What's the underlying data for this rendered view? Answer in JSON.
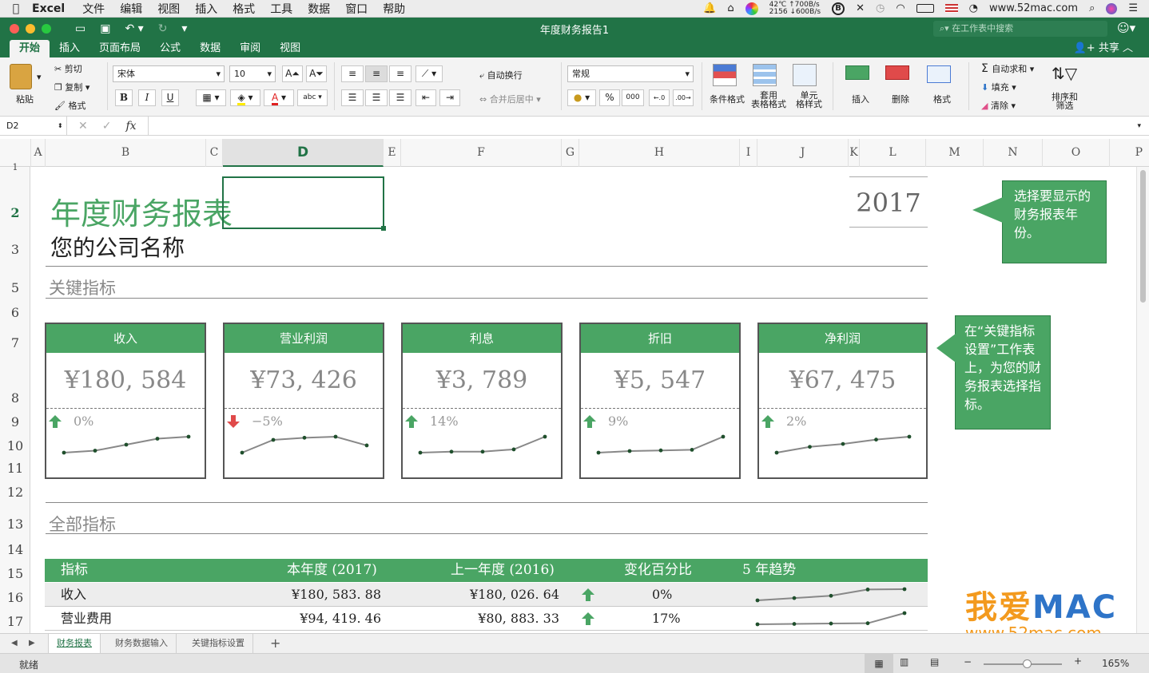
{
  "menubar": {
    "app": "Excel",
    "items": [
      "文件",
      "编辑",
      "视图",
      "插入",
      "格式",
      "工具",
      "数据",
      "窗口",
      "帮助"
    ],
    "temp": "42℃",
    "fan": "2156",
    "net_up": "↑700B/s",
    "net_down": "↓600B/s",
    "site": "www.52mac.com"
  },
  "window": {
    "title": "年度财务报告1",
    "search_placeholder": "在工作表中搜索"
  },
  "ribbon_tabs": [
    "开始",
    "插入",
    "页面布局",
    "公式",
    "数据",
    "审阅",
    "视图"
  ],
  "share_label": "共享",
  "ribbon": {
    "paste": "粘贴",
    "cut": "剪切",
    "copy": "复制",
    "format_painter": "格式",
    "font_name": "宋体",
    "font_size": "10",
    "bold": "B",
    "italic": "I",
    "underline": "U",
    "wrap_text": "自动换行",
    "merge_center": "合并后居中",
    "number_format": "常规",
    "percent": "%",
    "thousands": "000",
    "conditional_format": "条件格式",
    "table_format": "套用\n表格格式",
    "table_format_l1": "套用",
    "table_format_l2": "表格格式",
    "cell_style_l1": "单元",
    "cell_style_l2": "格样式",
    "insert": "插入",
    "delete": "删除",
    "format": "格式",
    "autosum": "自动求和",
    "fill": "填充",
    "clear": "清除",
    "sort_l1": "排序和",
    "sort_l2": "筛选"
  },
  "formula_bar": {
    "name_box": "D2",
    "fx": "fx",
    "value": ""
  },
  "columns": [
    "A",
    "B",
    "C",
    "D",
    "E",
    "F",
    "G",
    "H",
    "I",
    "J",
    "K",
    "L",
    "M",
    "N",
    "O",
    "P"
  ],
  "rows": [
    "1",
    "2",
    "3",
    "5",
    "6",
    "7",
    "8",
    "9",
    "10",
    "11",
    "12",
    "13",
    "14",
    "15",
    "16",
    "17"
  ],
  "sheet": {
    "title": "年度财务报表",
    "company": "您的公司名称",
    "year": "2017",
    "key_metrics_heading": "关键指标",
    "all_metrics_heading": "全部指标",
    "callout_year": "选择要显示的财务报表年份。",
    "callout_metrics": "在“关键指标设置”工作表上，为您的财务报表选择指标。",
    "cards": [
      {
        "label": "收入",
        "value": "¥180, 584",
        "change": "0%",
        "trend": "up",
        "spark": [
          180.0,
          180.1,
          180.4,
          180.7,
          180.8
        ]
      },
      {
        "label": "营业利润",
        "value": "¥73, 426",
        "change": "−5%",
        "trend": "down",
        "spark": [
          70,
          76,
          77,
          77.5,
          73.4
        ]
      },
      {
        "label": "利息",
        "value": "¥3, 789",
        "change": "14%",
        "trend": "up",
        "spark": [
          3.3,
          3.33,
          3.33,
          3.4,
          3.79
        ]
      },
      {
        "label": "折旧",
        "value": "¥5, 547",
        "change": "9%",
        "trend": "up",
        "spark": [
          5.05,
          5.1,
          5.12,
          5.14,
          5.55
        ]
      },
      {
        "label": "净利润",
        "value": "¥67, 475",
        "change": "2%",
        "trend": "up",
        "spark": [
          62,
          64,
          65,
          66.5,
          67.5
        ]
      }
    ],
    "table": {
      "headers": [
        "指标",
        "本年度 (2017)",
        "上一年度 (2016)",
        "变化百分比",
        "5 年趋势"
      ],
      "rows": [
        {
          "name": "收入",
          "current": "¥180, 583. 88",
          "previous": "¥180, 026. 64",
          "trend": "up",
          "change": "0%",
          "spark": [
            179.6,
            179.8,
            180.0,
            180.55,
            180.58
          ]
        },
        {
          "name": "营业费用",
          "current": "¥94, 419. 46",
          "previous": "¥80, 883. 33",
          "trend": "up",
          "change": "17%",
          "spark": [
            79.5,
            80.0,
            80.5,
            80.9,
            94.4
          ]
        }
      ]
    }
  },
  "sheet_tabs": [
    "财务报表",
    "财务数据输入",
    "关键指标设置"
  ],
  "add_sheet": "+",
  "status": {
    "ready": "就绪",
    "zoom": "165%",
    "zoom_fraction": 0.55
  },
  "watermark": {
    "cn": "我爱",
    "mac": "MAC",
    "url": "www.52mac.com"
  },
  "colors": {
    "excel_green": "#217346",
    "accent_green": "#4aa564",
    "down_red": "#e04a4a"
  }
}
